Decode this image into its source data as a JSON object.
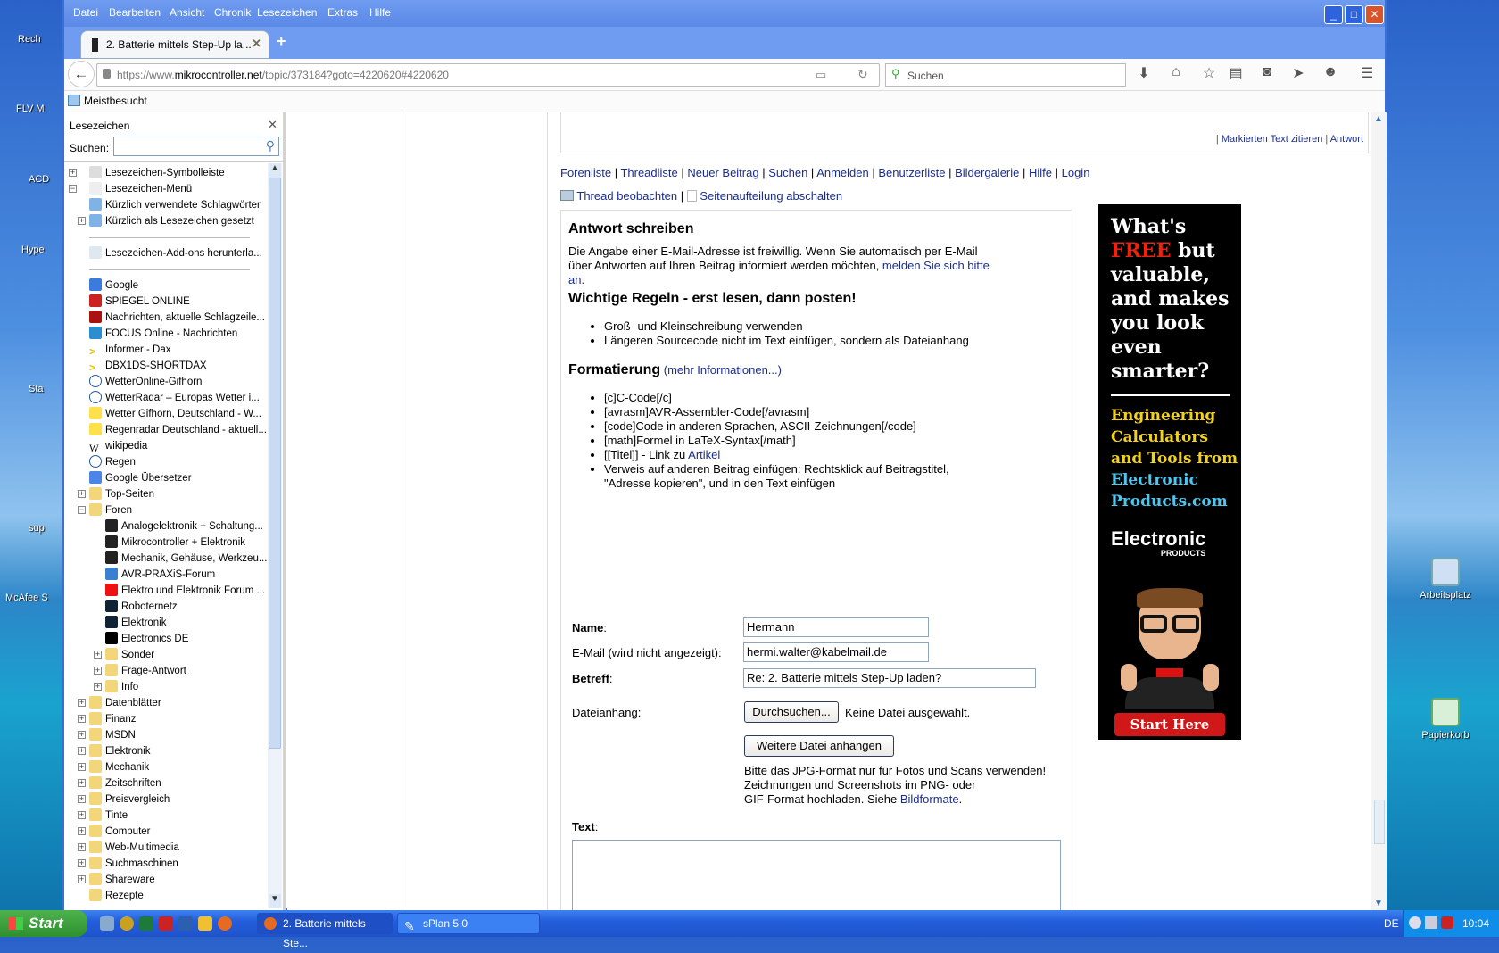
{
  "desktop": {
    "left_icons": [
      "Rech",
      "FLV M",
      "ACD",
      "Hype",
      "Sta",
      "sup",
      "McAfee S"
    ],
    "right_icons": [
      "Arbeitsplatz",
      "Papierkorb"
    ]
  },
  "menu": [
    "Datei",
    "Bearbeiten",
    "Ansicht",
    "Chronik",
    "Lesezeichen",
    "Extras",
    "Hilfe"
  ],
  "tab": {
    "title": "2. Batterie mittels Step-Up la..."
  },
  "url": {
    "prefix": "https://www.",
    "domain": "mikrocontroller.net",
    "path": "/topic/373184?goto=4220620#4220620"
  },
  "search": {
    "placeholder": "Suchen"
  },
  "bookmarks_toolbar": {
    "item": "Meistbesucht"
  },
  "sidebar": {
    "title": "Lesezeichen",
    "search_label": "Suchen:",
    "items": [
      {
        "l": "Lesezeichen-Symbolleiste",
        "d": 0,
        "e": "+",
        "i": "toolbar"
      },
      {
        "l": "Lesezeichen-Menü",
        "d": 0,
        "e": "-",
        "i": "menu"
      },
      {
        "l": "Kürzlich verwendete Schlagwörter",
        "d": 1,
        "i": "query"
      },
      {
        "l": "Kürzlich als Lesezeichen gesetzt",
        "d": 1,
        "e": "+",
        "i": "query"
      },
      {
        "sep": true
      },
      {
        "l": "Lesezeichen-Add-ons herunterla...",
        "d": 1,
        "i": "addon"
      },
      {
        "sep": true
      },
      {
        "l": "Google",
        "d": 1,
        "i": "google"
      },
      {
        "l": "SPIEGEL ONLINE",
        "d": 1,
        "i": "spiegel"
      },
      {
        "l": "Nachrichten, aktuelle Schlagzeile...",
        "d": 1,
        "i": "n"
      },
      {
        "l": "FOCUS Online - Nachrichten",
        "d": 1,
        "i": "focus"
      },
      {
        "l": "Informer - Dax",
        "d": 1,
        "i": "arrow"
      },
      {
        "l": "DBX1DS-SHORTDAX",
        "d": 1,
        "i": "arrow"
      },
      {
        "l": "WetterOnline-Gifhorn",
        "d": 1,
        "i": "globe"
      },
      {
        "l": "WetterRadar – Europas Wetter i...",
        "d": 1,
        "i": "globe"
      },
      {
        "l": "Wetter Gifhorn, Deutschland - W...",
        "d": 1,
        "i": "sun"
      },
      {
        "l": "Regenradar Deutschland - aktuell...",
        "d": 1,
        "i": "sun"
      },
      {
        "l": "wikipedia",
        "d": 1,
        "i": "wiki"
      },
      {
        "l": "Regen",
        "d": 1,
        "i": "globe"
      },
      {
        "l": "Google Übersetzer",
        "d": 1,
        "i": "translate"
      },
      {
        "l": "Top-Seiten",
        "d": 1,
        "e": "+",
        "i": "folder"
      },
      {
        "l": "Foren",
        "d": 1,
        "e": "-",
        "i": "folder"
      },
      {
        "l": "Analogelektronik + Schaltung...",
        "d": 2,
        "i": "chip"
      },
      {
        "l": "Mikrocontroller + Elektronik",
        "d": 2,
        "i": "chip"
      },
      {
        "l": "Mechanik, Gehäuse, Werkzeu...",
        "d": 2,
        "i": "chip"
      },
      {
        "l": "AVR-PRAXiS-Forum",
        "d": 2,
        "i": "avr"
      },
      {
        "l": "Elektro und Elektronik Forum ...",
        "d": 2,
        "i": "red"
      },
      {
        "l": "Roboternetz",
        "d": 2,
        "i": "robo"
      },
      {
        "l": "Elektronik",
        "d": 2,
        "i": "robo"
      },
      {
        "l": "Electronics DE",
        "d": 2,
        "i": "e"
      },
      {
        "l": "Sonder",
        "d": 2,
        "e": "+",
        "i": "folder"
      },
      {
        "l": "Frage-Antwort",
        "d": 2,
        "e": "+",
        "i": "folder"
      },
      {
        "l": "Info",
        "d": 2,
        "e": "+",
        "i": "folder"
      },
      {
        "l": "Datenblätter",
        "d": 1,
        "e": "+",
        "i": "folder"
      },
      {
        "l": "Finanz",
        "d": 1,
        "e": "+",
        "i": "folder"
      },
      {
        "l": "MSDN",
        "d": 1,
        "e": "+",
        "i": "folder"
      },
      {
        "l": "Elektronik",
        "d": 1,
        "e": "+",
        "i": "folder"
      },
      {
        "l": "Mechanik",
        "d": 1,
        "e": "+",
        "i": "folder"
      },
      {
        "l": "Zeitschriften",
        "d": 1,
        "e": "+",
        "i": "folder"
      },
      {
        "l": "Preisvergleich",
        "d": 1,
        "e": "+",
        "i": "folder"
      },
      {
        "l": "Tinte",
        "d": 1,
        "e": "+",
        "i": "folder"
      },
      {
        "l": "Computer",
        "d": 1,
        "e": "+",
        "i": "folder"
      },
      {
        "l": "Web-Multimedia",
        "d": 1,
        "e": "+",
        "i": "folder"
      },
      {
        "l": "Suchmaschinen",
        "d": 1,
        "e": "+",
        "i": "folder"
      },
      {
        "l": "Shareware",
        "d": 1,
        "e": "+",
        "i": "folder"
      },
      {
        "l": "Rezepte",
        "d": 1,
        "i": "folder"
      }
    ]
  },
  "post_actions": {
    "quote": "Markierten Text zitieren",
    "reply": "Antwort"
  },
  "forum_nav": [
    "Forenliste",
    "Threadliste",
    "Neuer Beitrag",
    "Suchen",
    "Anmelden",
    "Benutzerliste",
    "Bildergalerie",
    "Hilfe",
    "Login"
  ],
  "thread_actions": {
    "watch": "Thread beobachten",
    "paging": "Seitenaufteilung abschalten"
  },
  "form": {
    "heading": "Antwort schreiben",
    "intro1": "Die Angabe einer E-Mail-Adresse ist freiwillig. Wenn Sie automatisch per E-Mail",
    "intro2": "über Antworten auf Ihren Beitrag informiert werden möchten, ",
    "intro_link1": "melden Sie sich bitte",
    "intro_link2": "an.",
    "rules_heading": "Wichtige Regeln - erst lesen, dann posten!",
    "rules": [
      "Groß- und Kleinschreibung verwenden",
      "Längeren Sourcecode nicht im Text einfügen, sondern als Dateianhang"
    ],
    "format_heading": "Formatierung",
    "format_link": "(mehr Informationen...)",
    "format_items": [
      "[c]C-Code[/c]",
      "[avrasm]AVR-Assembler-Code[/avrasm]",
      "[code]Code in anderen Sprachen, ASCII-Zeichnungen[/code]",
      "[math]Formel in LaTeX-Syntax[/math]"
    ],
    "format_titel": "[[Titel]] - Link zu ",
    "format_titel_link": "Artikel",
    "format_ref1": "Verweis auf anderen Beitrag einfügen: Rechtsklick auf Beitragstitel,",
    "format_ref2": "\"Adresse kopieren\", und in den Text einfügen",
    "name_label": "Name",
    "name_value": "Hermann",
    "email_label": "E-Mail (wird nicht angezeigt):",
    "email_value": "hermi.walter@kabelmail.de",
    "subject_label": "Betreff",
    "subject_value": "Re: 2. Batterie mittels Step-Up laden?",
    "attach_label": "Dateianhang:",
    "browse_button": "Durchsuchen...",
    "no_file": "Keine Datei ausgewählt.",
    "more_file_button": "Weitere Datei anhängen",
    "hint1": "Bitte das JPG-Format nur für Fotos und Scans verwenden!",
    "hint2": "Zeichnungen und Screenshots im PNG- oder",
    "hint3": "GIF-Format hochladen. Siehe ",
    "hint_link": "Bildformate",
    "text_label": "Text"
  },
  "ad": {
    "line1": "What's",
    "free": "FREE",
    "line2": " but",
    "line3": "valuable,",
    "line4": "and makes",
    "line5": "you look",
    "line6": "even",
    "line7": "smarter?",
    "sub1": "Engineering",
    "sub2": "Calculators",
    "sub3": "and Tools from",
    "sub4": "Electronic",
    "sub5": "Products.com",
    "logo": "Electronic",
    "logo_sub": "PRODUCTS",
    "cta": "Start Here"
  },
  "taskbar": {
    "start": "Start",
    "tasks": [
      "2. Batterie mittels Ste...",
      "sPlan 5.0"
    ],
    "lang": "DE",
    "clock": "10:04"
  }
}
